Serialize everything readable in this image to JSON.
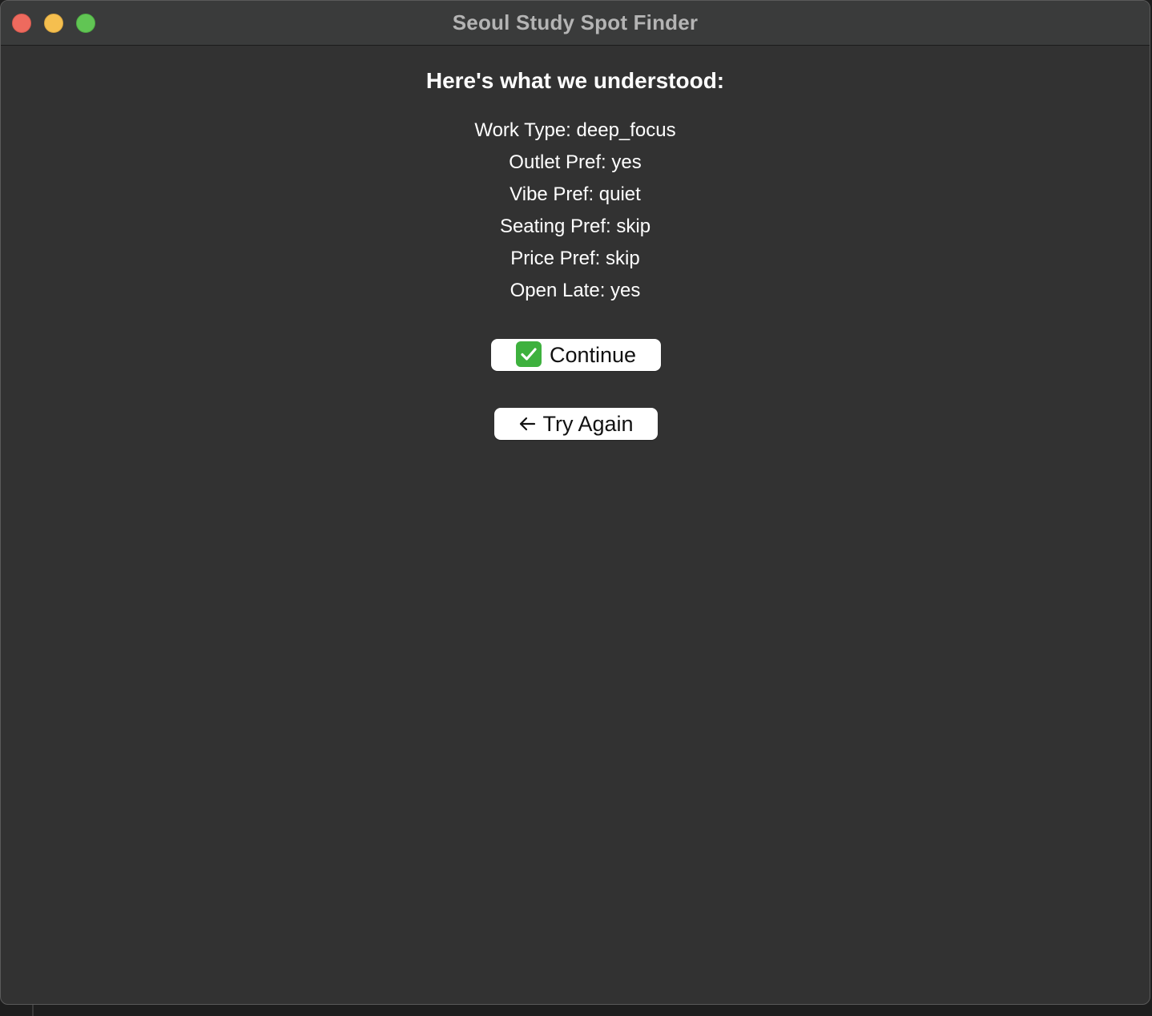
{
  "window": {
    "title": "Seoul Study Spot Finder"
  },
  "main": {
    "heading": "Here's what we understood:",
    "summary": [
      {
        "label": "Work Type",
        "value": "deep_focus",
        "text": "Work Type: deep_focus"
      },
      {
        "label": "Outlet Pref",
        "value": "yes",
        "text": "Outlet Pref: yes"
      },
      {
        "label": "Vibe Pref",
        "value": "quiet",
        "text": "Vibe Pref: quiet"
      },
      {
        "label": "Seating Pref",
        "value": "skip",
        "text": "Seating Pref: skip"
      },
      {
        "label": "Price Pref",
        "value": "skip",
        "text": "Price Pref: skip"
      },
      {
        "label": "Open Late",
        "value": "yes",
        "text": "Open Late: yes"
      }
    ],
    "continue_button": {
      "label": "Continue",
      "icon": "check-mark-icon"
    },
    "try_again_button": {
      "label": "Try Again",
      "icon": "arrow-left-icon"
    }
  },
  "colors": {
    "background": "#323232",
    "titlebar": "#3a3b3b",
    "text": "#ffffff",
    "button_bg": "#ffffff",
    "check_green": "#3eb13e"
  }
}
